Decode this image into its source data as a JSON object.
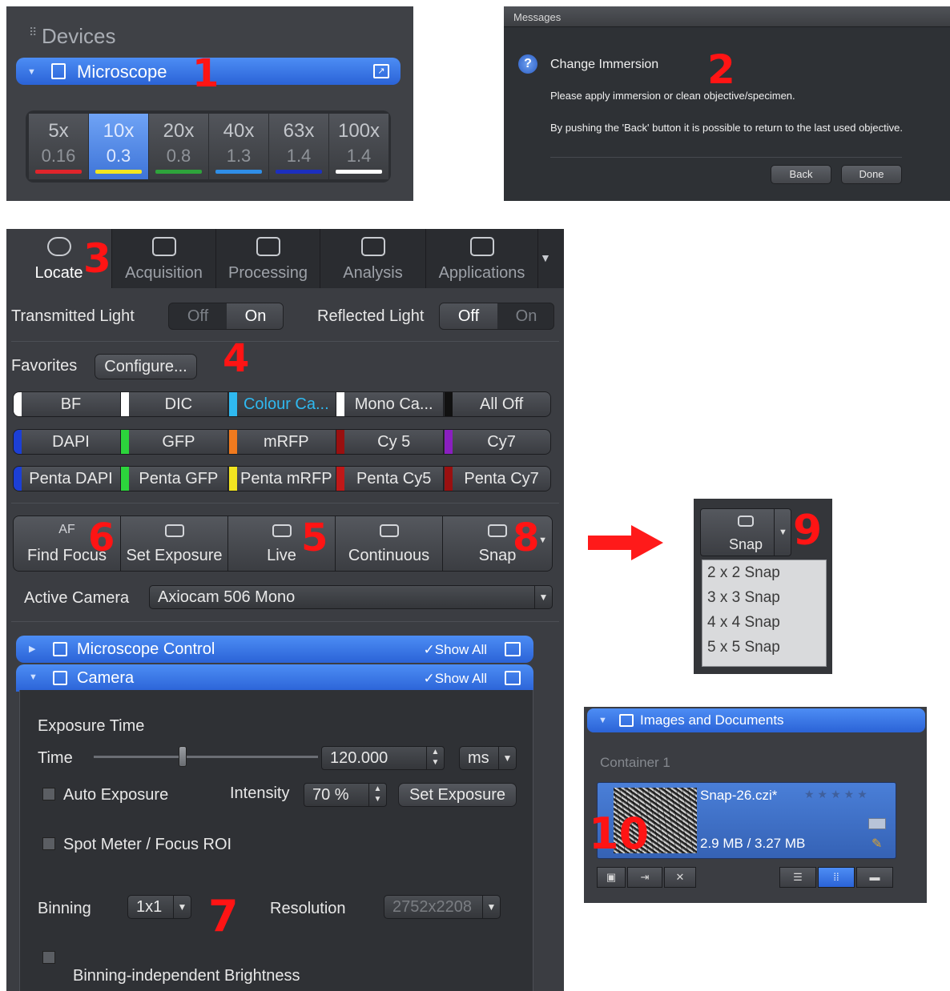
{
  "annotations": [
    "1",
    "2",
    "3",
    "4",
    "5",
    "6",
    "7",
    "8",
    "9",
    "10"
  ],
  "devices": {
    "title": "Devices",
    "microscope_label": "Microscope",
    "objectives": [
      {
        "mag": "5x",
        "na": "0.16",
        "color": "#e0242b",
        "selected": false
      },
      {
        "mag": "10x",
        "na": "0.3",
        "color": "#f2e520",
        "selected": true
      },
      {
        "mag": "20x",
        "na": "0.8",
        "color": "#2ea33b",
        "selected": false
      },
      {
        "mag": "40x",
        "na": "1.3",
        "color": "#2f8ee8",
        "selected": false
      },
      {
        "mag": "63x",
        "na": "1.4",
        "color": "#1c2fbf",
        "selected": false
      },
      {
        "mag": "100x",
        "na": "1.4",
        "color": "#ffffff",
        "selected": false
      }
    ]
  },
  "messages": {
    "window_title": "Messages",
    "title": "Change Immersion",
    "line1": "Please apply immersion or clean objective/specimen.",
    "line2": "By pushing the 'Back' button it is possible to return to the last used objective.",
    "back": "Back",
    "done": "Done"
  },
  "tabs": [
    {
      "label": "Locate",
      "active": true
    },
    {
      "label": "Acquisition",
      "active": false
    },
    {
      "label": "Processing",
      "active": false
    },
    {
      "label": "Analysis",
      "active": false
    },
    {
      "label": "Applications",
      "active": false
    }
  ],
  "light": {
    "transmitted_label": "Transmitted Light",
    "reflected_label": "Reflected Light",
    "off": "Off",
    "on": "On",
    "transmitted_state": "On",
    "reflected_state": "Off"
  },
  "favorites": {
    "label": "Favorites",
    "configure": "Configure...",
    "rows": [
      [
        {
          "label": "BF",
          "color": "#ffffff"
        },
        {
          "label": "DIC",
          "color": "#ffffff"
        },
        {
          "label": "Colour Ca...",
          "color": "#2fb9f0",
          "selected": true
        },
        {
          "label": "Mono Ca...",
          "color": "#ffffff"
        },
        {
          "label": "All Off",
          "color": "#111111"
        }
      ],
      [
        {
          "label": "DAPI",
          "color": "#1c3fd6"
        },
        {
          "label": "GFP",
          "color": "#2cd43c"
        },
        {
          "label": "mRFP",
          "color": "#f07a1e"
        },
        {
          "label": "Cy 5",
          "color": "#9a1010"
        },
        {
          "label": "Cy7",
          "color": "#8a1fc0"
        }
      ],
      [
        {
          "label": "Penta DAPI",
          "color": "#1c3fd6"
        },
        {
          "label": "Penta GFP",
          "color": "#2cd43c"
        },
        {
          "label": "Penta mRFP",
          "color": "#f2e520"
        },
        {
          "label": "Penta Cy5",
          "color": "#c01818"
        },
        {
          "label": "Penta Cy7",
          "color": "#9a1010"
        }
      ]
    ]
  },
  "acquire": {
    "af": "AF",
    "find_focus": "Find Focus",
    "set_exposure": "Set Exposure",
    "live": "Live",
    "continuous": "Continuous",
    "snap": "Snap"
  },
  "active_camera": {
    "label": "Active Camera",
    "value": "Axiocam 506 Mono"
  },
  "microscope_control": {
    "label": "Microscope Control",
    "show_all": "✓Show All"
  },
  "camera": {
    "label": "Camera",
    "show_all": "✓Show All",
    "exposure_time": "Exposure Time",
    "time_label": "Time",
    "time_value": "120.000",
    "time_unit": "ms",
    "auto_exposure": "Auto Exposure",
    "intensity_label": "Intensity",
    "intensity_value": "70 %",
    "set_exposure": "Set Exposure",
    "spot_meter": "Spot Meter / Focus ROI",
    "binning_label": "Binning",
    "binning_value": "1x1",
    "resolution_label": "Resolution",
    "resolution_value": "2752x2208",
    "binning_brightness": "Binning-independent Brightness"
  },
  "snap_menu": {
    "button": "Snap",
    "items": [
      "2 x 2 Snap",
      "3 x 3 Snap",
      "4 x 4 Snap",
      "5 x 5 Snap"
    ]
  },
  "images_docs": {
    "title": "Images and Documents",
    "container": "Container 1",
    "doc_name": "Snap-26.czi*",
    "rating": "★★★★★",
    "size": "2.9 MB / 3.27 MB"
  },
  "colors": {
    "accent": "#3a78e8",
    "annotation": "#ff1414",
    "arrow": "#ff1a1a"
  }
}
